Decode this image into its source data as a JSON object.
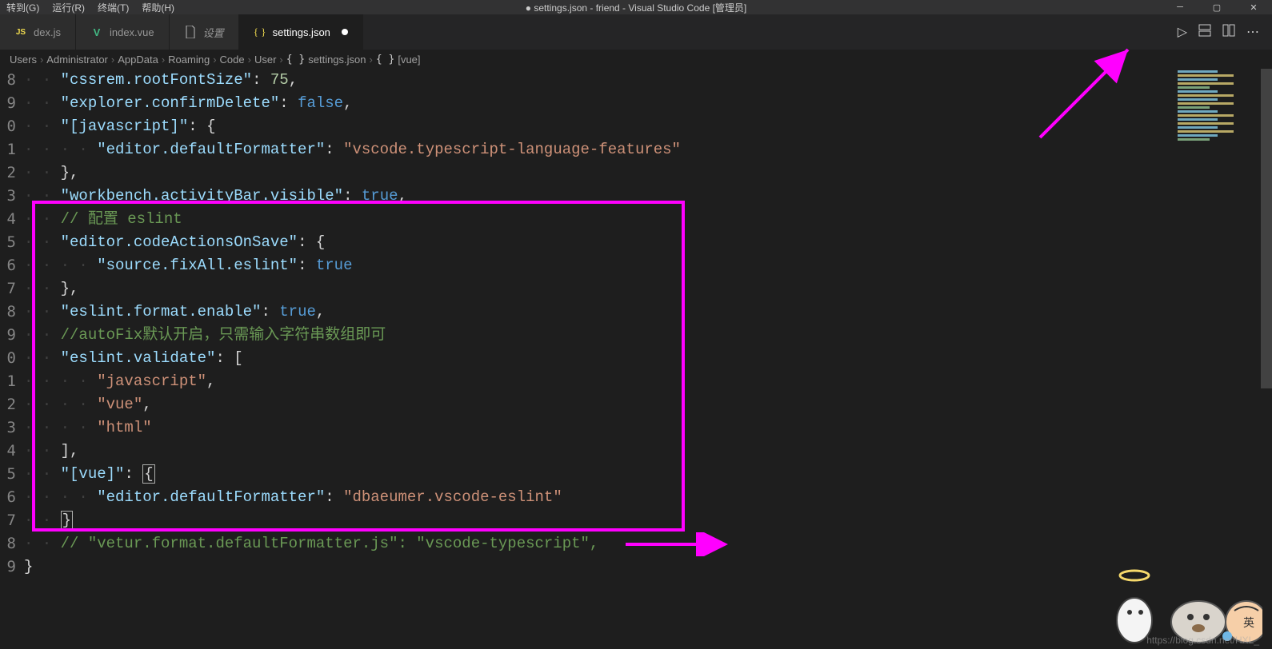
{
  "window": {
    "title": "● settings.json - friend - Visual Studio Code [管理员]"
  },
  "menus": {
    "goto": "转到(G)",
    "run": "运行(R)",
    "terminal": "终端(T)",
    "help": "帮助(H)"
  },
  "tabs": [
    {
      "label": "dex.js",
      "icon": "JS",
      "kind": "js"
    },
    {
      "label": "index.vue",
      "icon": "V",
      "kind": "vue"
    },
    {
      "label": "设置",
      "icon": "file",
      "kind": "settings"
    },
    {
      "label": "settings.json",
      "icon": "{}",
      "kind": "json",
      "active": true,
      "dirty": true
    }
  ],
  "toolbar": {
    "run": "▷",
    "split_down": "⇅",
    "split_right": "▥",
    "more": "⋯"
  },
  "breadcrumb": [
    {
      "label": "Users"
    },
    {
      "label": "Administrator"
    },
    {
      "label": "AppData"
    },
    {
      "label": "Roaming"
    },
    {
      "label": "Code"
    },
    {
      "label": "User"
    },
    {
      "label": "settings.json",
      "icon": "{}"
    },
    {
      "label": "[vue]",
      "icon": "{}"
    }
  ],
  "gutter": [
    "8",
    "9",
    "0",
    "1",
    "2",
    "3",
    "4",
    "5",
    "6",
    "7",
    "8",
    "9",
    "0",
    "1",
    "2",
    "3",
    "4",
    "5",
    "6",
    "7",
    "8",
    "9"
  ],
  "code": {
    "l0": {
      "k": "\"cssrem.rootFontSize\"",
      "n": "75"
    },
    "l1": {
      "k": "\"explorer.confirmDelete\"",
      "v": "false"
    },
    "l2": {
      "k": "\"[javascript]\"",
      "p": "{"
    },
    "l3": {
      "k": "\"editor.defaultFormatter\"",
      "s": "\"vscode.typescript-language-features\""
    },
    "l4": {
      "p": "},"
    },
    "l5": {
      "k": "\"workbench.activityBar.visible\"",
      "v": "true"
    },
    "l6": {
      "c": "// 配置 eslint"
    },
    "l7": {
      "k": "\"editor.codeActionsOnSave\"",
      "p": "{"
    },
    "l8": {
      "k": "\"source.fixAll.eslint\"",
      "v": "true"
    },
    "l9": {
      "p": "},"
    },
    "l10": {
      "k": "\"eslint.format.enable\"",
      "v": "true"
    },
    "l11": {
      "c": "//autoFix默认开启，只需输入字符串数组即可"
    },
    "l12": {
      "k": "\"eslint.validate\"",
      "p": "["
    },
    "l13": {
      "s": "\"javascript\""
    },
    "l14": {
      "s": "\"vue\""
    },
    "l15": {
      "s": "\"html\""
    },
    "l16": {
      "p": "],"
    },
    "l17": {
      "k": "\"[vue]\"",
      "p": "{"
    },
    "l18": {
      "k": "\"editor.defaultFormatter\"",
      "s": "\"dbaeumer.vscode-eslint\""
    },
    "l19": {
      "p": "}"
    },
    "l20": {
      "c": "// \"vetur.format.defaultFormatter.js\": \"vscode-typescript\","
    },
    "l21": {
      "p": "}"
    }
  },
  "watermark": "https://blog.csdn.net/HXL_"
}
